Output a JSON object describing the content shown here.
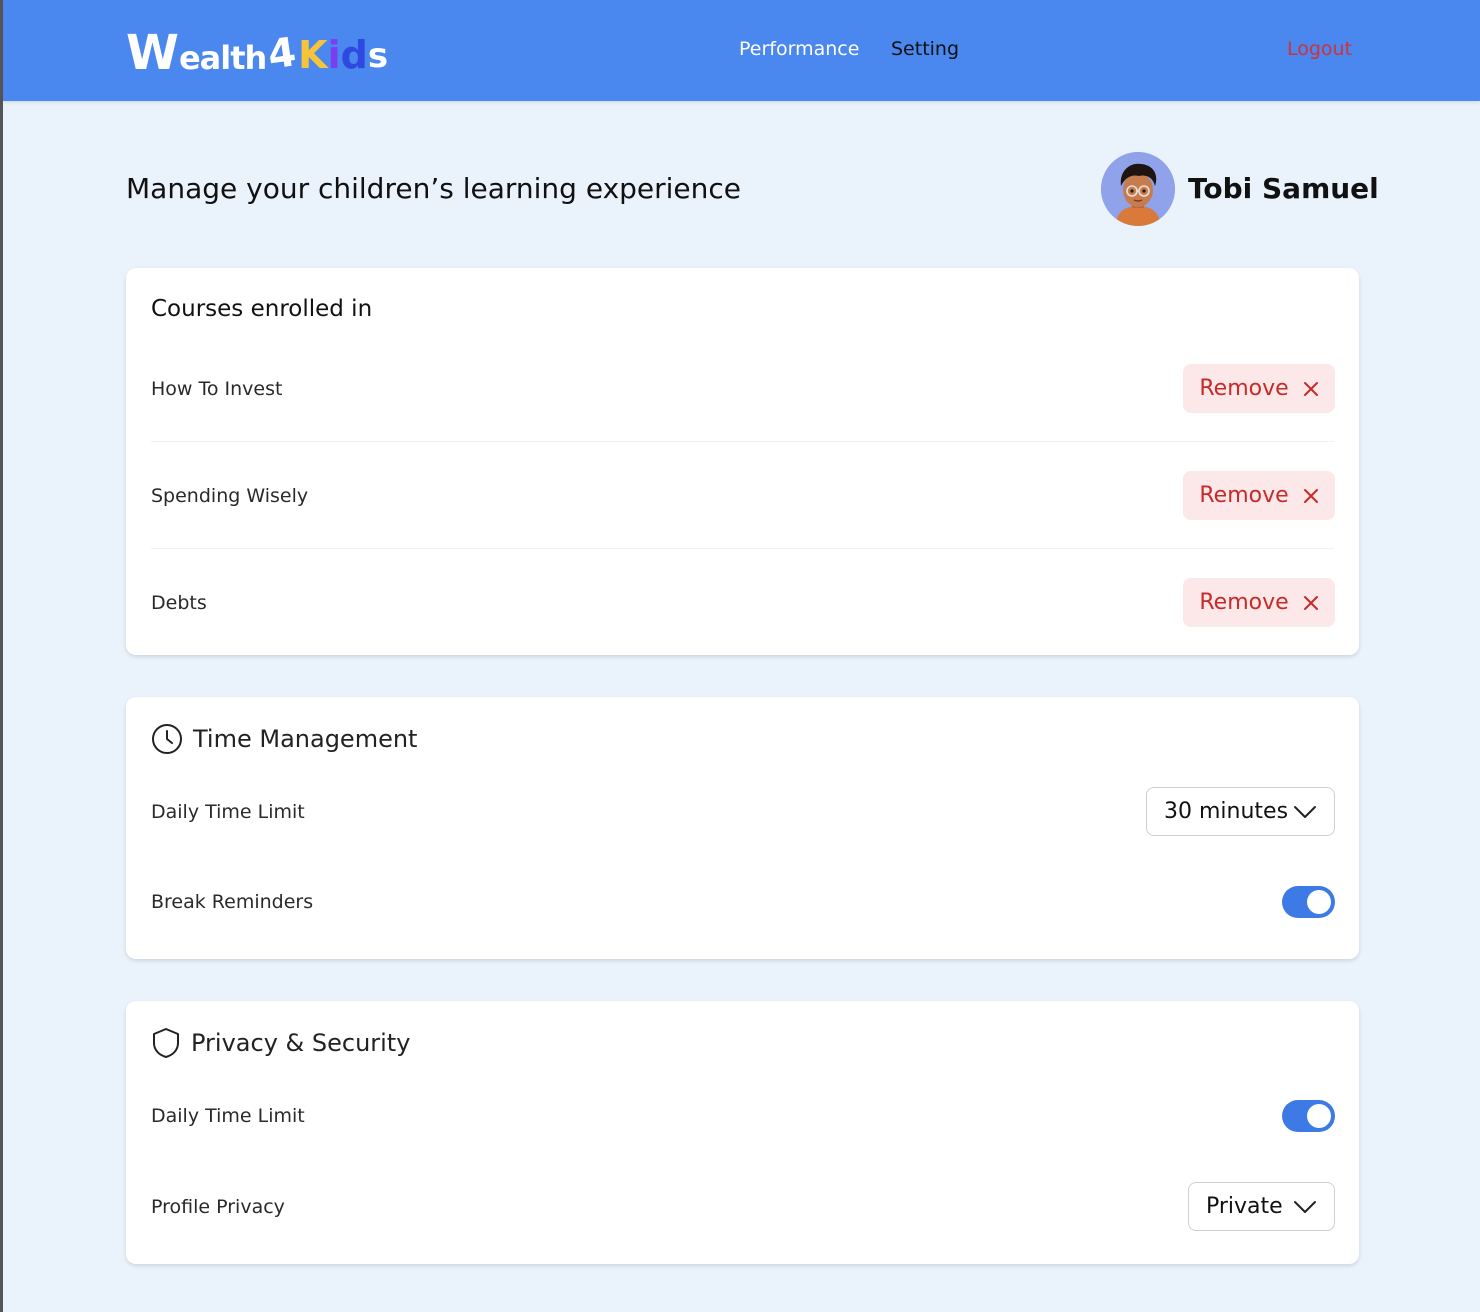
{
  "brand": {
    "logo_w": "W",
    "logo_ealth": "ealth",
    "logo_4": "4",
    "logo_k": "K",
    "logo_i": "i",
    "logo_d": "d",
    "logo_s": "s"
  },
  "nav": {
    "performance": "Performance",
    "setting": "Setting",
    "logout": "Logout"
  },
  "page": {
    "title": "Manage your children’s learning experience"
  },
  "user": {
    "name": "Tobi Samuel"
  },
  "courses": {
    "title": "Courses enrolled in",
    "remove_label": "Remove",
    "items": [
      {
        "name": "How To Invest"
      },
      {
        "name": "Spending Wisely"
      },
      {
        "name": "Debts"
      }
    ]
  },
  "time_management": {
    "title": "Time Management",
    "daily_limit_label": "Daily Time Limit",
    "daily_limit_value": "30 minutes",
    "break_reminders_label": "Break Reminders",
    "break_reminders_on": true
  },
  "privacy": {
    "title": "Privacy & Security",
    "daily_limit_label": "Daily Time Limit",
    "daily_limit_on": true,
    "profile_privacy_label": "Profile Privacy",
    "profile_privacy_value": "Private"
  },
  "colors": {
    "header": "#4a87ee",
    "background": "#eaf2fc",
    "danger": "#c72a2a",
    "toggle_on": "#3d7ae6"
  }
}
